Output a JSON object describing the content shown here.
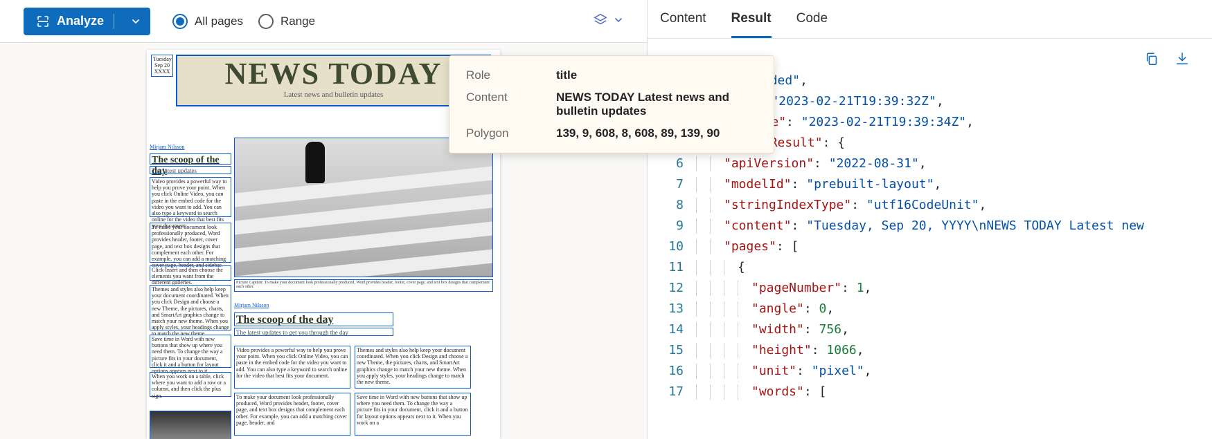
{
  "toolbar": {
    "analyze_label": "Analyze",
    "radio_all": "All pages",
    "radio_range": "Range"
  },
  "tooltip": {
    "role_key": "Role",
    "role_val": "title",
    "content_key": "Content",
    "content_val": "NEWS TODAY Latest news and bulletin updates",
    "polygon_key": "Polygon",
    "polygon_val": "139, 9, 608, 8, 608, 89, 139, 90"
  },
  "document": {
    "date_line1": "Tuesday",
    "date_line2": "Sep 20",
    "date_line3": "XXXX",
    "title": "NEWS TODAY",
    "subtitle": "Latest news and bulletin updates",
    "author1": "Mirjam Nilsson",
    "scoop_heading": "The scoop of the day",
    "scoop_sub": "The latest updates",
    "para1": "Video provides a powerful way to help you prove your point. When you click Online Video, you can paste in the embed code for the video you want to add. You can also type a keyword to search online for the video that best fits your document.",
    "para2": "To make your document look professionally produced, Word provides header, footer, cover page, and text box designs that complement each other. For example, you can add a matching cover page, header, and sidebar.",
    "para3": "Click Insert and then choose the elements you want from the different galleries.",
    "para4": "Themes and styles also help keep your document coordinated. When you click Design and choose a new Theme, the pictures, charts, and SmartArt graphics change to match your new theme. When you apply styles, your headings change to match the new theme.",
    "para5": "Save time in Word with new buttons that show up where you need them. To change the way a picture fits in your document, click it and a button for layout options appears next to it.",
    "para6": "When you work on a table, click where you want to add a row or a column, and then click the plus sign.",
    "caption": "Picture Caption: To make your document look professionally produced, Word provides header, footer, cover page, and text box designs that complement each other.",
    "author2": "Mirjam Nilsson",
    "scoop2_heading": "The scoop of the day",
    "scoop2_sub": "The latest updates to get you through the day",
    "col_a": "Video provides a powerful way to help you prove your point. When you click Online Video, you can paste in the embed code for the video you want to add. You can also type a keyword to search online for the video that best fits your document.",
    "col_b": "Themes and styles also help keep your document coordinated. When you click Design and choose a new Theme, the pictures, charts, and SmartArt graphics change to match your new theme. When you apply styles, your headings change to match the new theme.",
    "col_c": "To make your document look professionally produced, Word provides header, footer, cover page, and text box designs that complement each other. For example, you can add a matching cover page, header, and",
    "col_d": "Save time in Word with new buttons that show up where you need them. To change the way a picture fits in your document, click it and a button for layout options appears next to it. When you work on a"
  },
  "tabs": {
    "content": "Content",
    "result": "Result",
    "code": "Code"
  },
  "json_result": {
    "lines": [
      {
        "n": "",
        "indent": 1,
        "frag_key": "",
        "text_html": "<span class='tk-str'>\"succeeded\"</span><span class='tk-plain'>,</span>"
      },
      {
        "n": "",
        "indent": 0,
        "frag_key": "ateTime",
        "text_html": "<span class='tk-plain'>: </span><span class='tk-str'>\"2023-02-21T19:39:32Z\"</span><span class='tk-plain'>,</span>"
      },
      {
        "n": "",
        "indent": 0,
        "frag_key": "tedDateTime",
        "text_html": "<span class='tk-plain'>: </span><span class='tk-str'>\"2023-02-21T19:39:34Z\"</span><span class='tk-plain'>,</span>"
      },
      {
        "n": "5",
        "indent": 1,
        "key": "analyzeResult",
        "after": "<span class='tk-plain'>: {</span>"
      },
      {
        "n": "6",
        "indent": 2,
        "key": "apiVersion",
        "after": "<span class='tk-plain'>: </span><span class='tk-str'>\"2022-08-31\"</span><span class='tk-plain'>,</span>"
      },
      {
        "n": "7",
        "indent": 2,
        "key": "modelId",
        "after": "<span class='tk-plain'>: </span><span class='tk-str'>\"prebuilt-layout\"</span><span class='tk-plain'>,</span>"
      },
      {
        "n": "8",
        "indent": 2,
        "key": "stringIndexType",
        "after": "<span class='tk-plain'>: </span><span class='tk-str'>\"utf16CodeUnit\"</span><span class='tk-plain'>,</span>"
      },
      {
        "n": "9",
        "indent": 2,
        "key": "content",
        "after": "<span class='tk-plain'>: </span><span class='tk-str'>\"Tuesday, Sep 20, YYYY\\nNEWS TODAY Latest new</span>"
      },
      {
        "n": "10",
        "indent": 2,
        "key": "pages",
        "after": "<span class='tk-plain'>: [</span>"
      },
      {
        "n": "11",
        "indent": 3,
        "plain": "{"
      },
      {
        "n": "12",
        "indent": 4,
        "key": "pageNumber",
        "after": "<span class='tk-plain'>: </span><span class='tk-num'>1</span><span class='tk-plain'>,</span>"
      },
      {
        "n": "13",
        "indent": 4,
        "key": "angle",
        "after": "<span class='tk-plain'>: </span><span class='tk-num'>0</span><span class='tk-plain'>,</span>"
      },
      {
        "n": "14",
        "indent": 4,
        "key": "width",
        "after": "<span class='tk-plain'>: </span><span class='tk-num'>756</span><span class='tk-plain'>,</span>"
      },
      {
        "n": "15",
        "indent": 4,
        "key": "height",
        "after": "<span class='tk-plain'>: </span><span class='tk-num'>1066</span><span class='tk-plain'>,</span>"
      },
      {
        "n": "16",
        "indent": 4,
        "key": "unit",
        "after": "<span class='tk-plain'>: </span><span class='tk-str'>\"pixel\"</span><span class='tk-plain'>,</span>"
      },
      {
        "n": "17",
        "indent": 4,
        "key": "words",
        "after": "<span class='tk-plain'>: [</span>"
      }
    ]
  }
}
